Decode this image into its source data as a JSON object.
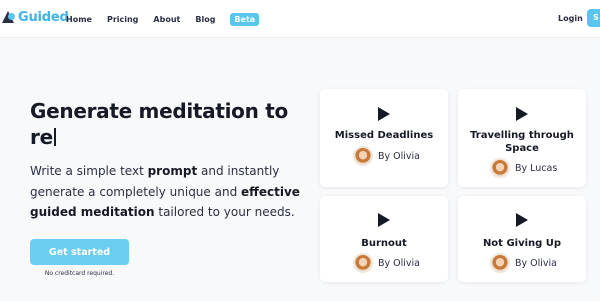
{
  "header": {
    "logo_text": "Guided",
    "nav": [
      {
        "label": "Home"
      },
      {
        "label": "Pricing"
      },
      {
        "label": "About"
      },
      {
        "label": "Blog"
      }
    ],
    "beta_badge": "Beta",
    "login_label": "Login",
    "signup_label": "S"
  },
  "hero": {
    "headline": "Generate meditation to re",
    "description_parts": {
      "p1": "Write a simple text ",
      "b1": "prompt",
      "p2": " and instantly generate a completely unique and ",
      "b2": "effective guided meditation",
      "p3": " tailored to your needs."
    },
    "cta_label": "Get started",
    "cta_note": "No creditcard required."
  },
  "cards": [
    {
      "title": "Missed Deadlines",
      "author": "By Olivia"
    },
    {
      "title": "Travelling through Space",
      "author": "By Lucas"
    },
    {
      "title": "Burnout",
      "author": "By Olivia"
    },
    {
      "title": "Not Giving Up",
      "author": "By Olivia"
    }
  ],
  "colors": {
    "accent": "#58c6ee",
    "text": "#161a26",
    "background": "#f8f9fb"
  }
}
